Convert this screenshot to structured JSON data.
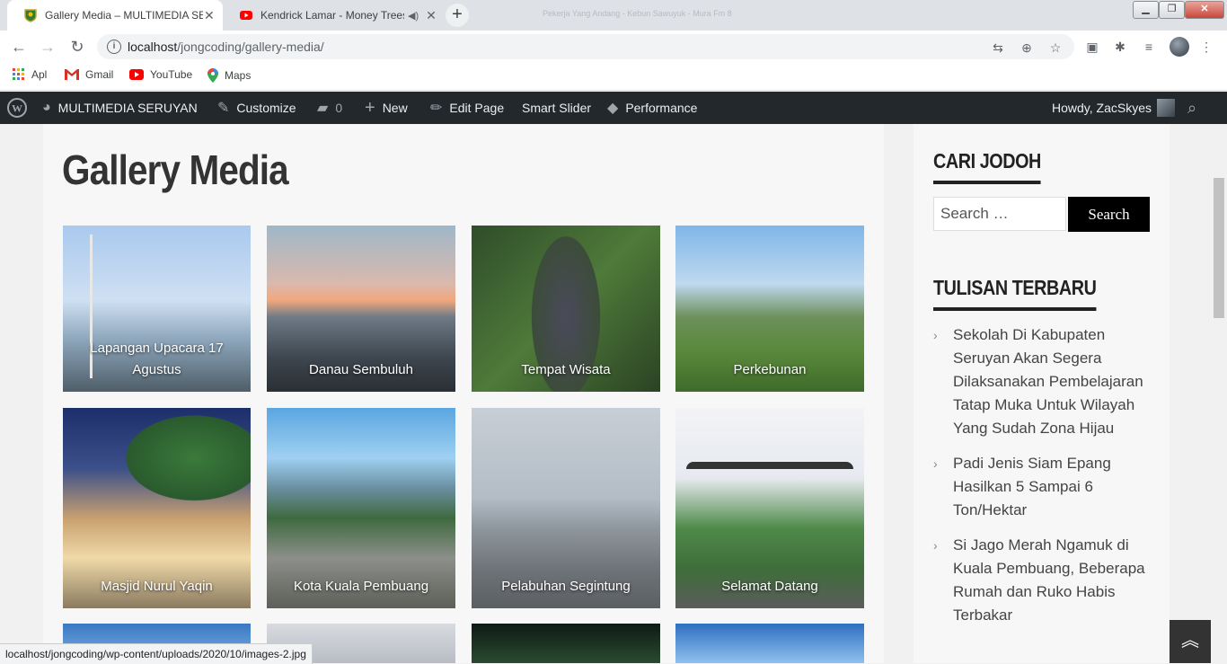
{
  "browser": {
    "tabs": [
      {
        "title": "Gallery Media – MULTIMEDIA SERUYAN",
        "active": true
      },
      {
        "title": "Kendrick Lamar - Money Trees",
        "active": false
      }
    ],
    "ghost_title": "Pekerja Yang Andang - Kebun Sawuyuk - Mura Fm 8",
    "url_host": "localhost",
    "url_path": "/jongcoding/gallery-media/",
    "bookmarks": [
      {
        "label": "Apl",
        "icon": "apps-grid-icon"
      },
      {
        "label": "Gmail",
        "icon": "gmail-icon"
      },
      {
        "label": "YouTube",
        "icon": "youtube-icon"
      },
      {
        "label": "Maps",
        "icon": "maps-pin-icon"
      }
    ]
  },
  "adminbar": {
    "site_name": "MULTIMEDIA SERUYAN",
    "customize": "Customize",
    "comments_count": "0",
    "new": "New",
    "edit_page": "Edit Page",
    "smart_slider": "Smart Slider",
    "performance": "Performance",
    "howdy": "Howdy, ZacSkyes"
  },
  "page": {
    "title": "Gallery Media",
    "gallery": [
      {
        "caption": "Lapangan Upacara 17 Agustus"
      },
      {
        "caption": "Danau Sembuluh"
      },
      {
        "caption": "Tempat Wisata"
      },
      {
        "caption": "Perkebunan"
      },
      {
        "caption": "Masjid Nurul Yaqin"
      },
      {
        "caption": "Kota Kuala Pembuang"
      },
      {
        "caption": "Pelabuhan Segintung"
      },
      {
        "caption": "Selamat Datang"
      }
    ]
  },
  "sidebar": {
    "search_title": "CARI JODOH",
    "search_placeholder": "Search …",
    "search_button": "Search",
    "recent_title": "TULISAN TERBARU",
    "recent_posts": [
      "Sekolah Di Kabupaten Seruyan Akan Segera Dilaksanakan Pembelajaran Tatap Muka Untuk Wilayah Yang Sudah Zona Hijau",
      "Padi Jenis Siam Epang Hasilkan 5 Sampai 6 Ton/Hektar",
      "Si Jago Merah Ngamuk di Kuala Pembuang, Beberapa Rumah dan Ruko Habis Terbakar"
    ]
  },
  "statusbar": "localhost/jongcoding/wp-content/uploads/2020/10/images-2.jpg",
  "colors": {
    "adminbar_bg": "#23282d",
    "search_button_bg": "#000000",
    "page_bg": "#f7f7f7"
  }
}
